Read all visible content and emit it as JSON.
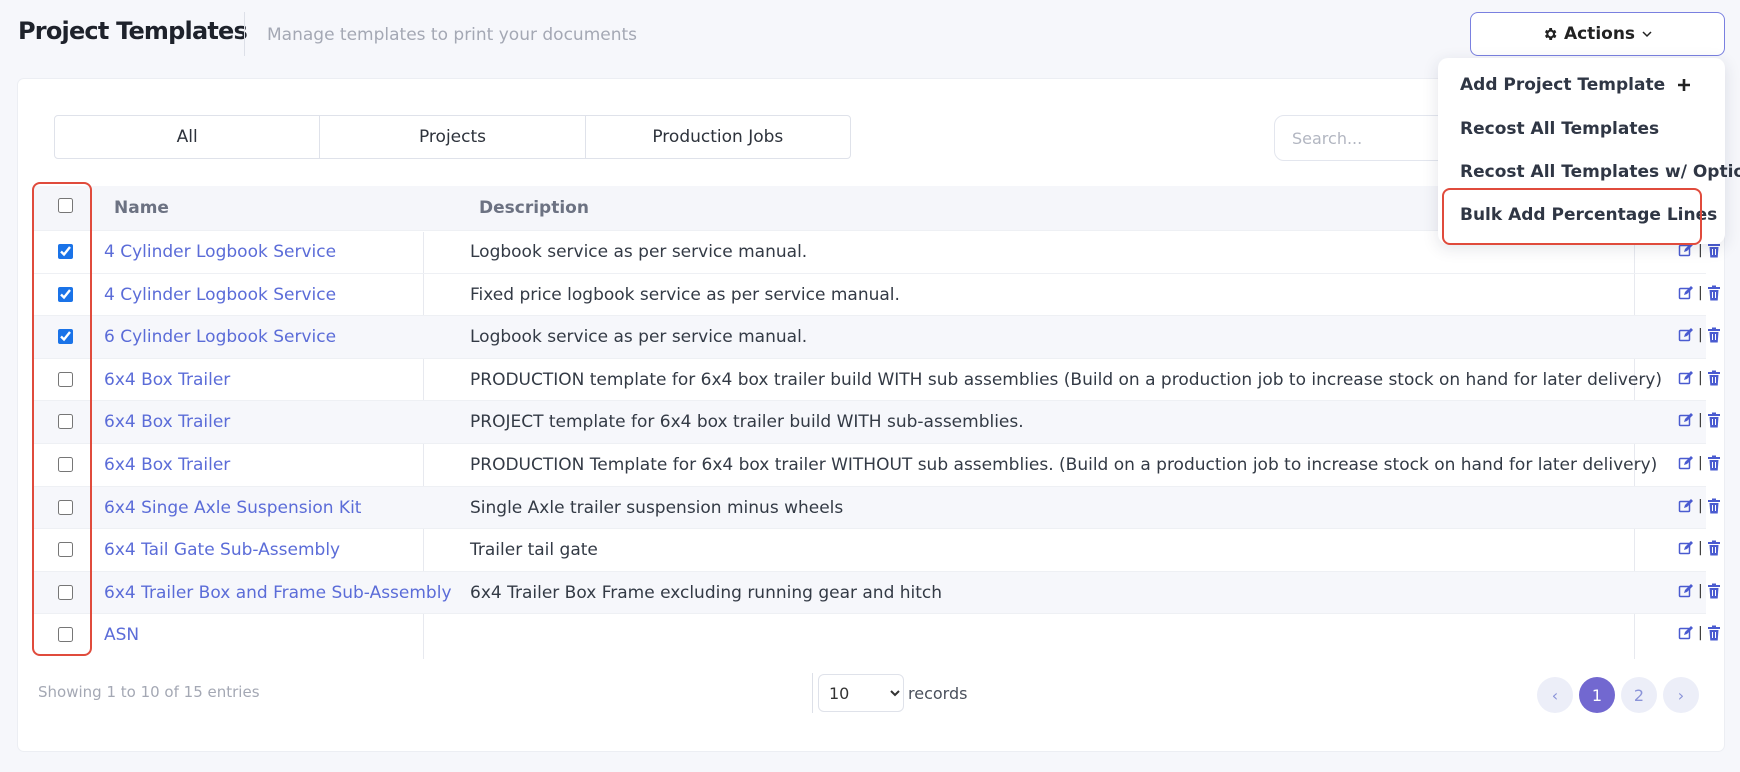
{
  "header": {
    "title": "Project Templates",
    "subtitle": "Manage templates to print your documents",
    "actions_label": "Actions"
  },
  "actions_menu": {
    "items": [
      {
        "label": "Add Project Template"
      },
      {
        "label": "Recost All Templates"
      },
      {
        "label": "Recost All Templates w/ Options"
      },
      {
        "label": "Bulk Add Percentage Lines"
      }
    ]
  },
  "filters": {
    "tabs": [
      {
        "label": "All"
      },
      {
        "label": "Projects"
      },
      {
        "label": "Production Jobs"
      }
    ]
  },
  "search": {
    "placeholder": "Search..."
  },
  "table": {
    "columns": {
      "name": "Name",
      "description": "Description"
    },
    "rows": [
      {
        "name": "4 Cylinder Logbook Service",
        "description": "Logbook service as per service manual.",
        "checked": true
      },
      {
        "name": "4 Cylinder Logbook Service",
        "description": "Fixed price logbook service as per service manual.",
        "checked": true
      },
      {
        "name": "6 Cylinder Logbook Service",
        "description": "Logbook service as per service manual.",
        "checked": true
      },
      {
        "name": "6x4 Box Trailer",
        "description": "PRODUCTION template for 6x4 box trailer build WITH sub assemblies (Build on a production job to increase stock on hand for later delivery)",
        "checked": false
      },
      {
        "name": "6x4 Box Trailer",
        "description": "PROJECT template for 6x4 box trailer build WITH sub-assemblies.",
        "checked": false
      },
      {
        "name": "6x4 Box Trailer",
        "description": "PRODUCTION Template for 6x4 box trailer WITHOUT sub assemblies. (Build on a production job to increase stock on hand for later delivery)",
        "checked": false
      },
      {
        "name": "6x4 Singe Axle Suspension Kit",
        "description": "Single Axle trailer suspension minus wheels",
        "checked": false
      },
      {
        "name": "6x4 Tail Gate Sub-Assembly",
        "description": "Trailer tail gate",
        "checked": false
      },
      {
        "name": "6x4 Trailer Box and Frame Sub-Assembly",
        "description": "6x4 Trailer Box Frame excluding running gear and hitch",
        "checked": false
      },
      {
        "name": "ASN",
        "description": "",
        "checked": false
      }
    ]
  },
  "footer": {
    "info": "Showing 1 to 10 of 15 entries",
    "records_value": "10",
    "records_options": [
      "10"
    ],
    "records_label": "records",
    "pages": [
      "1",
      "2"
    ],
    "prev": "‹",
    "next": "›"
  },
  "colors": {
    "link": "#5b6cd8",
    "accent": "#7268d0",
    "highlight": "#e04b3c",
    "icon": "#4a5bd0"
  }
}
